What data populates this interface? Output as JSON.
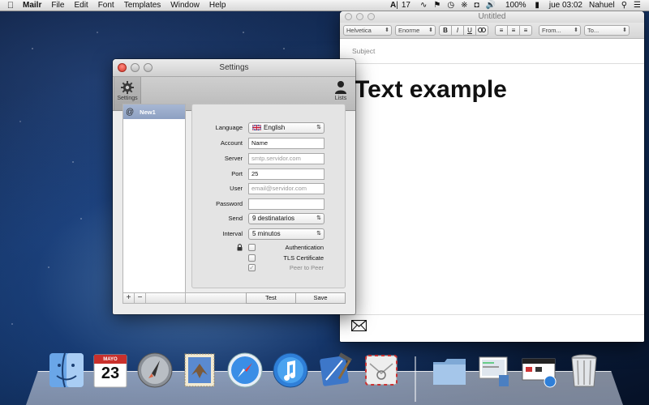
{
  "menubar": {
    "app_name": "Mailr",
    "menus": [
      "File",
      "Edit",
      "Font",
      "Templates",
      "Window",
      "Help"
    ],
    "status": {
      "adobe_count": "17",
      "battery": "100%",
      "clock": "jue 03:02",
      "user": "Nahuel"
    }
  },
  "compose": {
    "title": "Untitled",
    "font_family": "Helvetica",
    "font_size": "Enorme",
    "format_buttons": [
      "B",
      "I",
      "U",
      "∞"
    ],
    "from_label": "From...",
    "to_label": "To...",
    "subject_placeholder": "Subject",
    "body": "Text example"
  },
  "settings": {
    "title": "Settings",
    "toolbar": {
      "settings_label": "Settings",
      "lists_label": "Lists"
    },
    "accounts": [
      {
        "label": "New1"
      }
    ],
    "list_buttons": {
      "add": "+",
      "remove": "−"
    },
    "form": {
      "language_label": "Language",
      "language_value": "English",
      "account_label": "Account",
      "account_value": "Name",
      "server_label": "Server",
      "server_placeholder": "smtp.servidor.com",
      "port_label": "Port",
      "port_value": "25",
      "user_label": "User",
      "user_placeholder": "email@servidor.com",
      "password_label": "Password",
      "password_value": "",
      "send_label": "Send",
      "send_value": "9 destinatarios",
      "interval_label": "Interval",
      "interval_value": "5 minutos",
      "authentication_label": "Authentication",
      "authentication_checked": false,
      "tls_label": "TLS Certificate",
      "tls_checked": false,
      "p2p_label": "Peer to Peer",
      "p2p_checked": true
    },
    "buttons": {
      "test": "Test",
      "save": "Save"
    }
  },
  "dock": {
    "calendar_month": "MAYO",
    "calendar_day": "23",
    "apps": [
      "finder",
      "calendar",
      "launchpad",
      "mail",
      "safari",
      "itunes",
      "xcode",
      "mailr",
      "downloads",
      "preview",
      "app",
      "trash"
    ]
  }
}
